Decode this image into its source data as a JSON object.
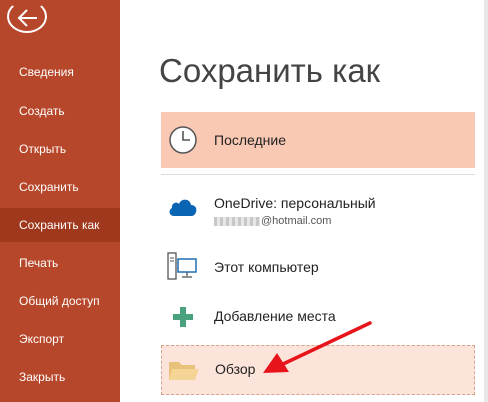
{
  "sidebar": {
    "items": [
      {
        "label": "Сведения"
      },
      {
        "label": "Создать"
      },
      {
        "label": "Открыть"
      },
      {
        "label": "Сохранить"
      },
      {
        "label": "Сохранить как"
      },
      {
        "label": "Печать"
      },
      {
        "label": "Общий доступ"
      },
      {
        "label": "Экспорт"
      },
      {
        "label": "Закрыть"
      }
    ],
    "active_index": 4
  },
  "page": {
    "title": "Сохранить как"
  },
  "locations": {
    "recent": {
      "label": "Последние",
      "icon": "clock-icon"
    },
    "onedrive": {
      "label": "OneDrive: персональный",
      "account": "@hotmail.com",
      "icon": "cloud-icon"
    },
    "computer": {
      "label": "Этот компьютер",
      "icon": "computer-icon"
    },
    "add_place": {
      "label": "Добавление места",
      "icon": "plus-icon"
    },
    "browse": {
      "label": "Обзор",
      "icon": "folder-icon"
    }
  },
  "colors": {
    "sidebar": "#b7472a",
    "sidebar_active": "#a0381d",
    "recent_highlight": "#f9c9b4",
    "browse_highlight": "#fde4da",
    "arrow": "#e8141b",
    "onedrive": "#0a64b4"
  }
}
